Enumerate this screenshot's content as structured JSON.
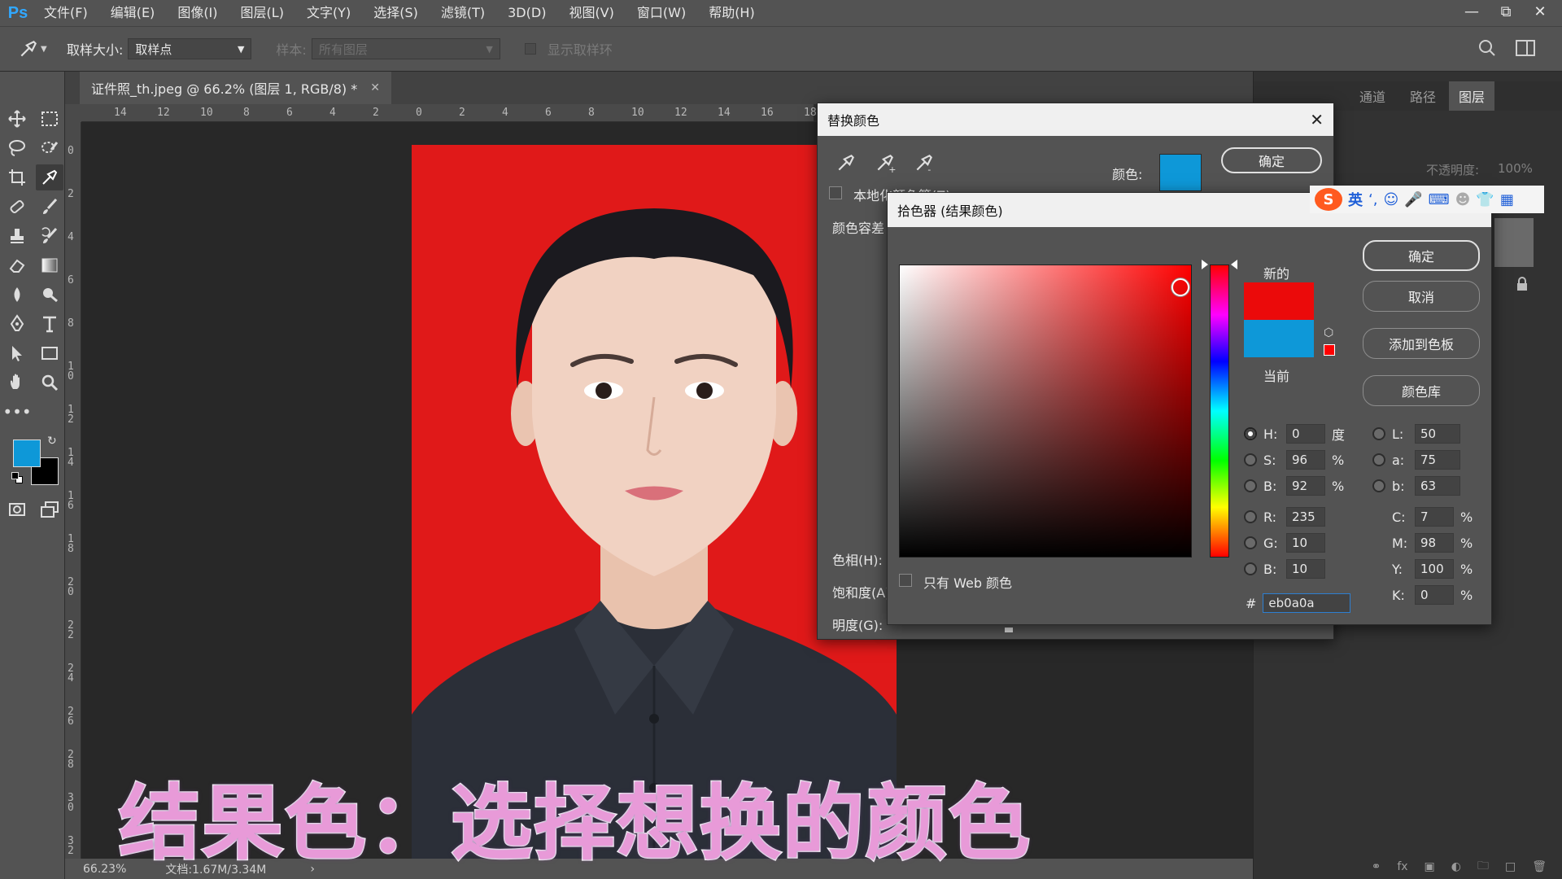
{
  "menubar": {
    "logo": "Ps",
    "items": [
      "文件(F)",
      "编辑(E)",
      "图像(I)",
      "图层(L)",
      "文字(Y)",
      "选择(S)",
      "滤镜(T)",
      "3D(D)",
      "视图(V)",
      "窗口(W)",
      "帮助(H)"
    ]
  },
  "options": {
    "sample_size_label": "取样大小:",
    "sample_size_value": "取样点",
    "sample_label": "样本:",
    "sample_value": "所有图层",
    "show_ring_label": "显示取样环"
  },
  "document": {
    "tab_title": "证件照_th.jpeg @ 66.2% (图层 1, RGB/8) *",
    "ruler_h": [
      "14",
      "12",
      "10",
      "8",
      "6",
      "4",
      "2",
      "0",
      "2",
      "4",
      "6",
      "8",
      "10",
      "12",
      "14",
      "16",
      "18"
    ],
    "ruler_v": [
      "0",
      "2",
      "4",
      "6",
      "8",
      "10",
      "12",
      "14",
      "16",
      "18",
      "20",
      "22",
      "24",
      "26",
      "28",
      "30",
      "32"
    ]
  },
  "status": {
    "zoom": "66.23%",
    "doc_info": "文档:1.67M/3.34M"
  },
  "right_panel": {
    "tabs": [
      "通道",
      "路径",
      "图层"
    ],
    "opacity_label": "不透明度:",
    "opacity_value": "100%"
  },
  "replace_color": {
    "title": "替换颜色",
    "color_label": "颜色:",
    "ok": "确定",
    "localized_label": "本地化颜色簇(Z)",
    "tolerance_label": "颜色容差",
    "hue_label": "色相(H):",
    "saturation_label": "饱和度(A)",
    "lightness_label": "明度(G):",
    "swatch_color": "#0e98d8"
  },
  "color_picker": {
    "title": "拾色器 (结果颜色)",
    "ok": "确定",
    "cancel": "取消",
    "add_swatch": "添加到色板",
    "color_library": "颜色库",
    "new_label": "新的",
    "current_label": "当前",
    "new_color": "#eb0a0a",
    "current_color": "#0e98d8",
    "web_only_label": "只有 Web 颜色",
    "hex_value": "eb0a0a",
    "fields_left": [
      {
        "label": "H:",
        "value": "0",
        "unit": "度",
        "selected": true
      },
      {
        "label": "S:",
        "value": "96",
        "unit": "%",
        "selected": false
      },
      {
        "label": "B:",
        "value": "92",
        "unit": "%",
        "selected": false
      },
      {
        "label": "R:",
        "value": "235",
        "unit": "",
        "selected": false
      },
      {
        "label": "G:",
        "value": "10",
        "unit": "",
        "selected": false
      },
      {
        "label": "B:",
        "value": "10",
        "unit": "",
        "selected": false
      }
    ],
    "fields_lab": [
      {
        "label": "L:",
        "value": "50"
      },
      {
        "label": "a:",
        "value": "75"
      },
      {
        "label": "b:",
        "value": "63"
      }
    ],
    "fields_cmyk": [
      {
        "label": "C:",
        "value": "7",
        "unit": "%"
      },
      {
        "label": "M:",
        "value": "98",
        "unit": "%"
      },
      {
        "label": "Y:",
        "value": "100",
        "unit": "%"
      },
      {
        "label": "K:",
        "value": "0",
        "unit": "%"
      }
    ]
  },
  "ime": {
    "lang": "英",
    "logo": "S"
  },
  "caption": "结果色：选择想换的颜色",
  "colors": {
    "foreground": "#0e98d8",
    "background": "#000000",
    "photo_bg": "#e01919"
  }
}
